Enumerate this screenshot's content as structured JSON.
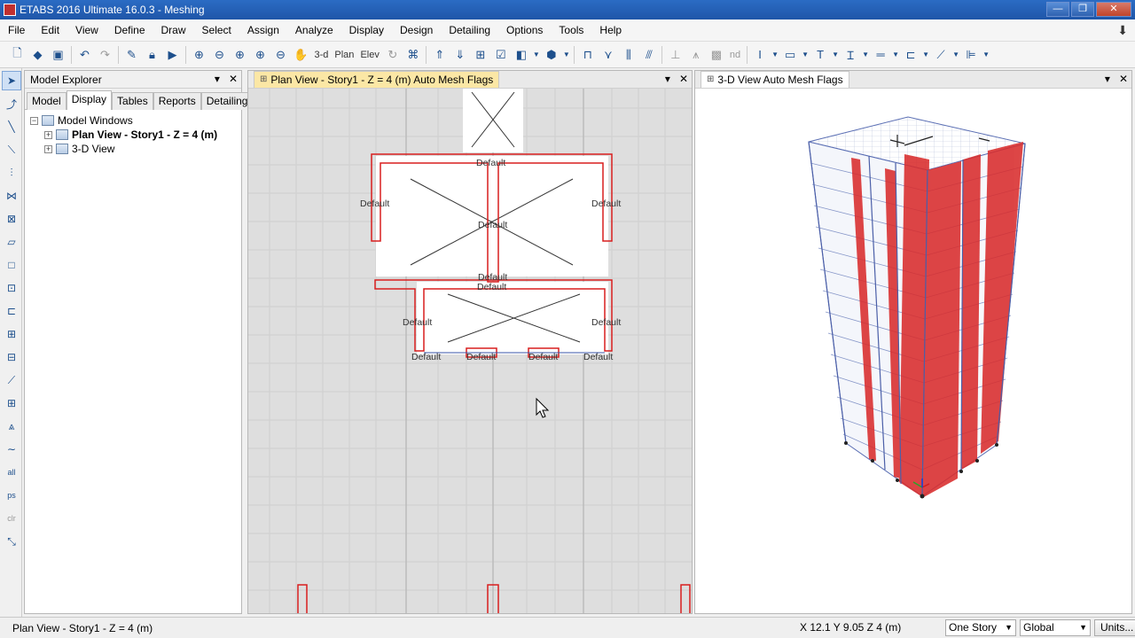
{
  "window": {
    "title": "ETABS 2016 Ultimate 16.0.3 - Meshing",
    "min": "—",
    "max": "❐",
    "close": "✕"
  },
  "menu": [
    "File",
    "Edit",
    "View",
    "Define",
    "Draw",
    "Select",
    "Assign",
    "Analyze",
    "Display",
    "Design",
    "Detailing",
    "Options",
    "Tools",
    "Help"
  ],
  "toolbar": {
    "view3d_label": "3-d",
    "plan_label": "Plan",
    "elev_label": "Elev",
    "nd_label": "nd"
  },
  "explorer": {
    "title": "Model Explorer",
    "tabs": [
      "Model",
      "Display",
      "Tables",
      "Reports",
      "Detailing"
    ],
    "active_tab": "Display",
    "tree": {
      "root": "Model Windows",
      "children": [
        "Plan View - Story1 - Z = 4 (m)",
        "3-D View"
      ]
    }
  },
  "plan_view": {
    "tab_label": "Plan View - Story1 - Z = 4 (m)  Auto Mesh Flags",
    "labels": [
      "Default",
      "Default",
      "Default",
      "Default",
      "Default",
      "Default",
      "Default",
      "Default",
      "Default",
      "Default",
      "Default",
      "Default",
      "Default"
    ]
  },
  "view_3d": {
    "tab_label": "3-D View  Auto Mesh Flags"
  },
  "status": {
    "left": "Plan View - Story1 - Z = 4 (m)",
    "coords": "X 12.1  Y 9.05  Z 4 (m)",
    "story_select": "One Story",
    "coord_system": "Global",
    "units_button": "Units..."
  },
  "colors": {
    "title_bar": "#1f56a8",
    "active_tab": "#fbe7a5",
    "wall_red": "#d91e1e",
    "canvas_gray": "#dedede"
  }
}
